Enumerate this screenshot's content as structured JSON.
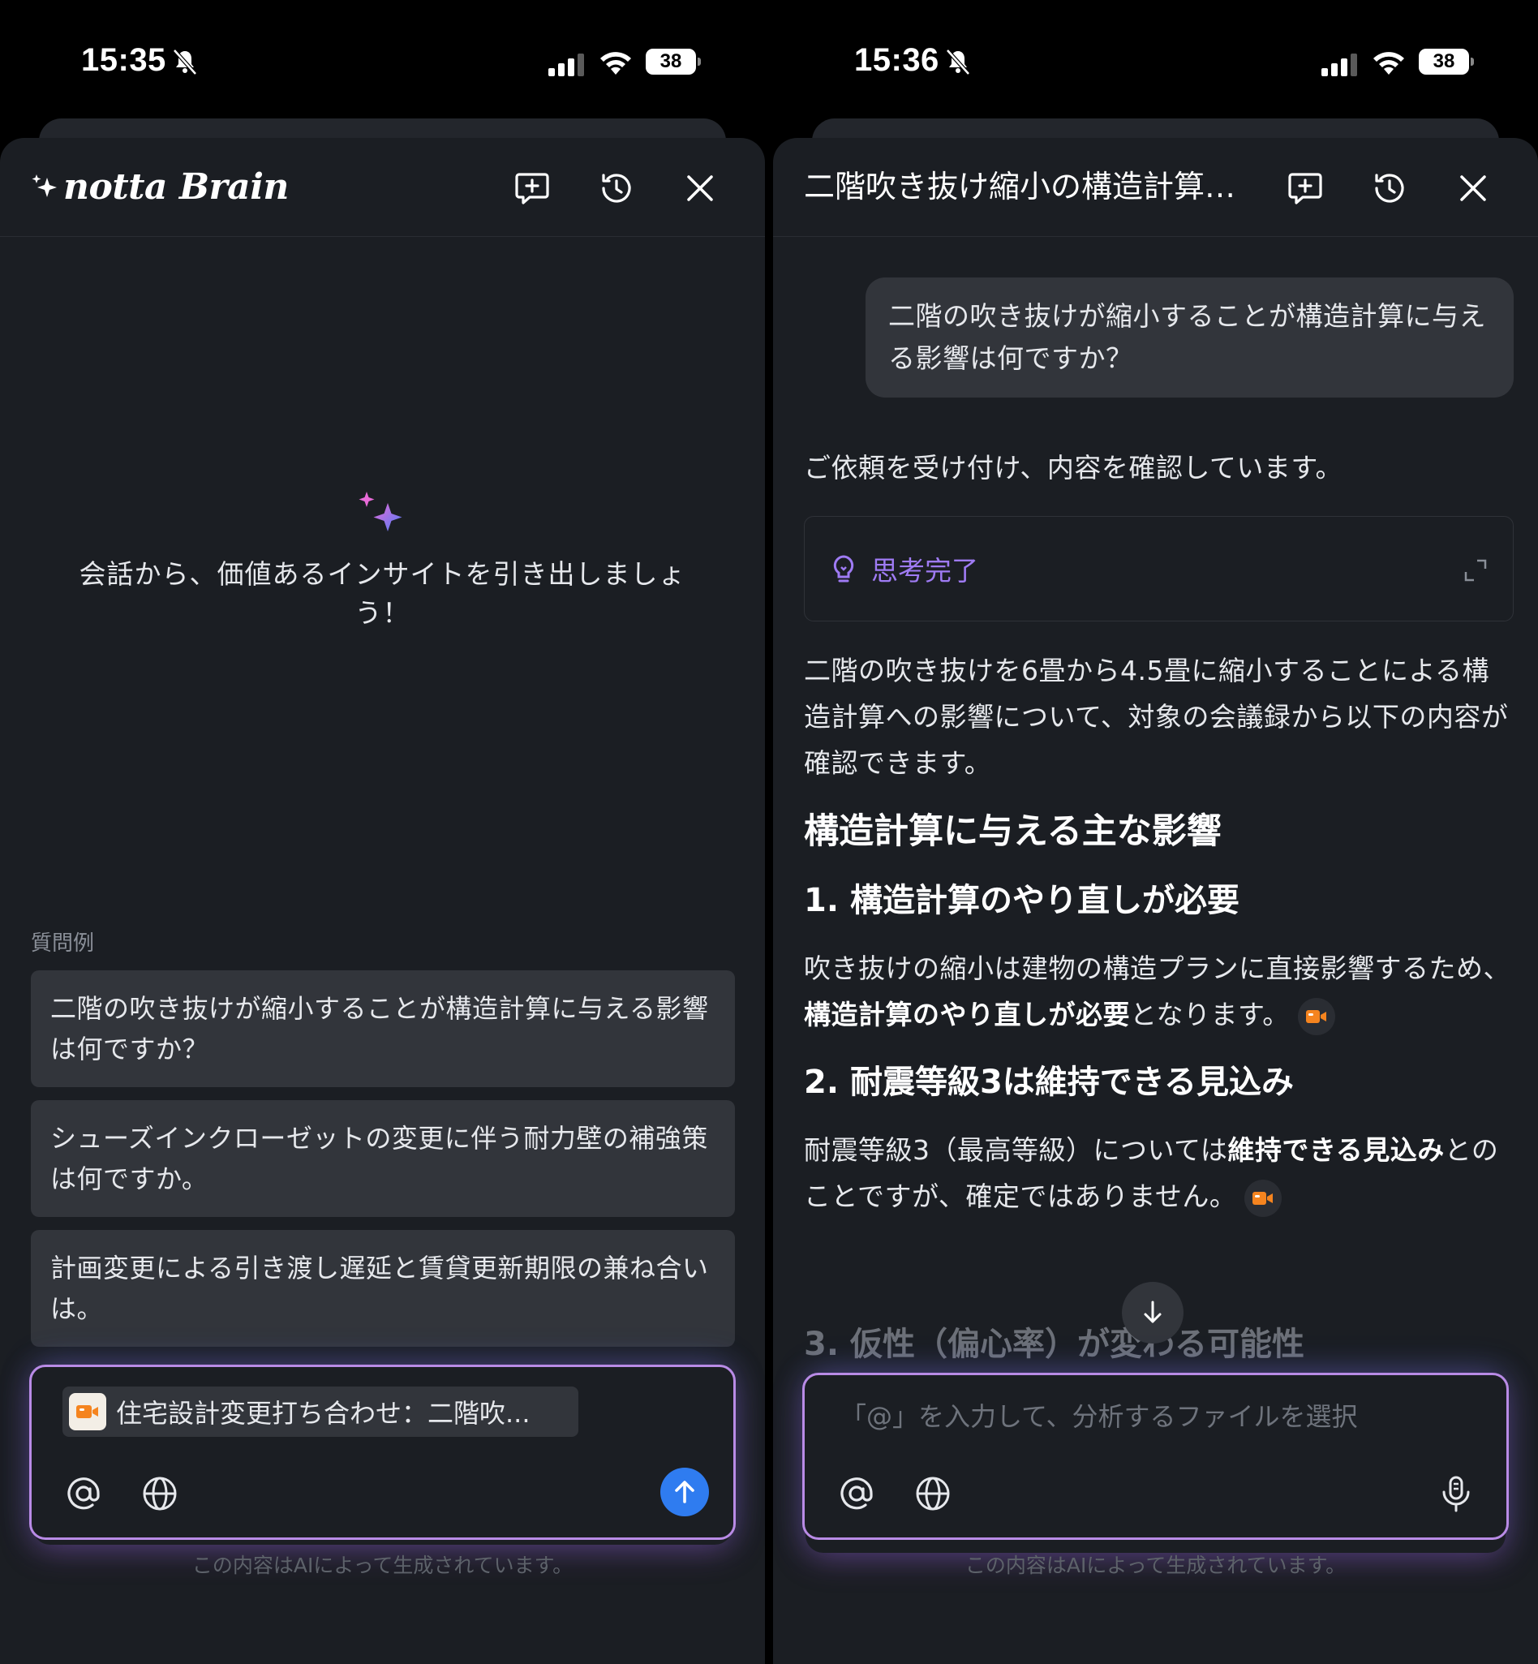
{
  "left": {
    "status": {
      "time": "15:35",
      "battery": "38"
    },
    "header": {
      "logo_text": "notta Brain"
    },
    "hero_text": "会話から、価値あるインサイトを引き出しましょう！",
    "examples_label": "質問例",
    "examples": [
      "二階の吹き抜けが縮小することが構造計算に与える影響は何ですか？",
      "シューズインクローゼットの変更に伴う耐力壁の補強策は何ですか。",
      "計画変更による引き渡し遅延と賃貸更新期限の兼ね合いは。"
    ],
    "input": {
      "chip_text": "住宅設計変更打ち合わせ：二階吹..."
    },
    "disclaimer": "この内容はAIによって生成されています。"
  },
  "right": {
    "status": {
      "time": "15:36",
      "battery": "38"
    },
    "header": {
      "title": "二階吹き抜け縮小の構造計算…"
    },
    "user_message": "二階の吹き抜けが縮小することが構造計算に与える影響は何ですか？",
    "ack": "ご依頼を受け付け、内容を確認しています。",
    "thinking_label": "思考完了",
    "answer": {
      "intro": "二階の吹き抜けを6畳から4.5畳に縮小することによる構造計算への影響について、対象の会議録から以下の内容が確認できます。",
      "heading": "構造計算に与える主な影響",
      "item1_title": "1. 構造計算のやり直しが必要",
      "item1_pre": "吹き抜けの縮小は建物の構造プランに直接影響するため、",
      "item1_bold": "構造計算のやり直しが必要",
      "item1_post": "となります。",
      "item2_title": "2. 耐震等級3は維持できる見込み",
      "item2_pre": "耐震等級3（最高等級）については",
      "item2_bold": "維持できる見込み",
      "item2_post": "とのことですが、確定ではありません。",
      "item3_title": "3. 仮性（偏心率）が変わる可能性"
    },
    "input": {
      "placeholder": "「@」を入力して、分析するファイルを選択"
    },
    "disclaimer": "この内容はAIによって生成されています。"
  },
  "colors": {
    "accent_purple": "#9f7bf4",
    "send_blue": "#2f7cf0",
    "record_orange": "#f5841f"
  }
}
